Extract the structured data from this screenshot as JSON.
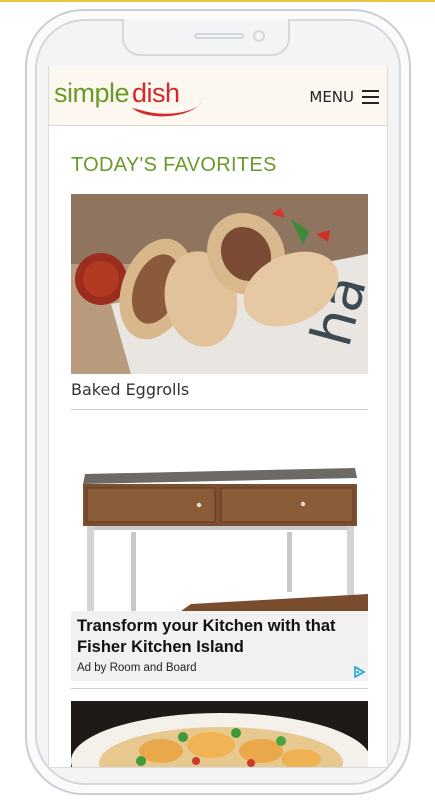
{
  "header": {
    "logo_simple": "simple",
    "logo_dish": "dish",
    "menu_label": "MENU"
  },
  "section": {
    "title": "TODAY'S FAVORITES"
  },
  "cards": [
    {
      "title": "Baked Eggrolls"
    }
  ],
  "ad": {
    "headline": "Transform your Kitchen with that Fisher Kitchen Island",
    "byline": "Ad by Room and Board"
  },
  "colors": {
    "brand_green": "#6a9a2a",
    "brand_red": "#d8262c",
    "header_bg": "#fcf7ef"
  }
}
